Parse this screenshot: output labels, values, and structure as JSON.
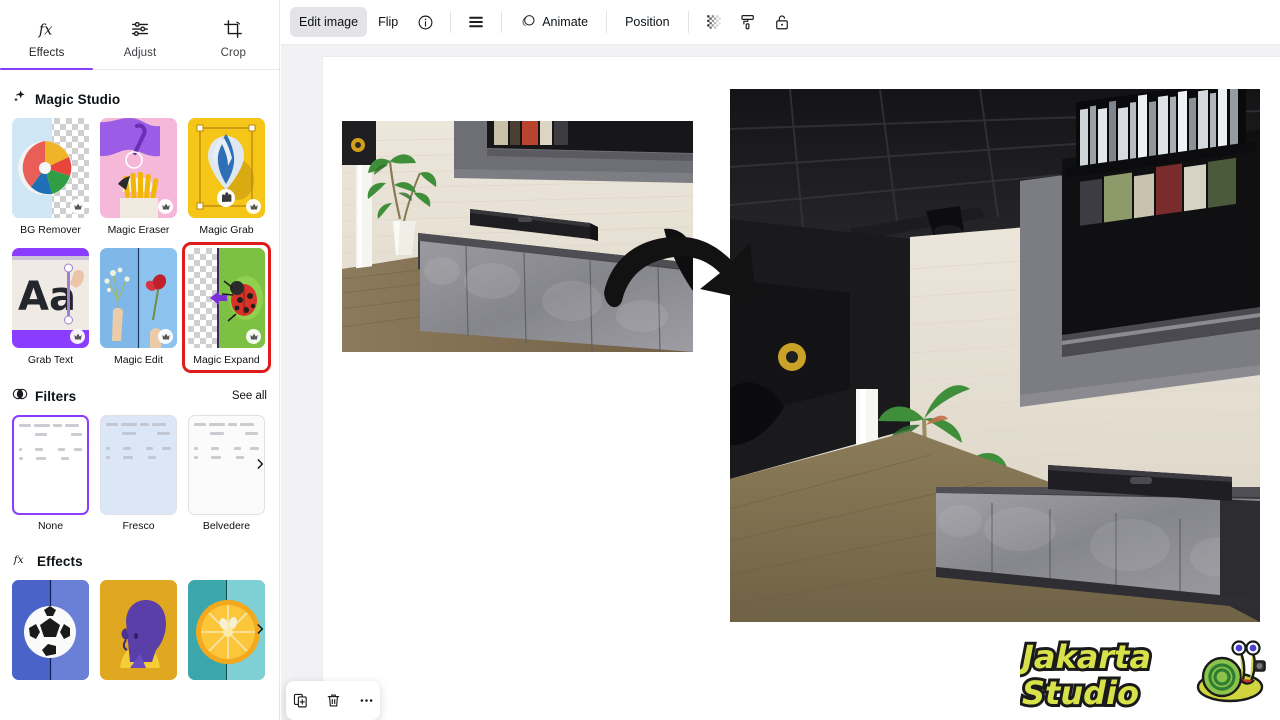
{
  "app": {
    "accent_purple": "#8b3dff",
    "selection_red": "#e01b1b",
    "panel_bg": "#ffffff",
    "canvas_bg": "#f2f2f4"
  },
  "left_panel": {
    "tabs": [
      {
        "label": "Effects",
        "icon": "fx-icon",
        "active": true
      },
      {
        "label": "Adjust",
        "icon": "sliders-icon",
        "active": false
      },
      {
        "label": "Crop",
        "icon": "crop-icon",
        "active": false
      }
    ],
    "magic_studio": {
      "title": "Magic Studio",
      "icon": "sparkle-icon",
      "cards": [
        {
          "label": "BG Remover",
          "premium": true,
          "selected": false
        },
        {
          "label": "Magic Eraser",
          "premium": true,
          "selected": false
        },
        {
          "label": "Magic Grab",
          "premium": true,
          "selected": false
        },
        {
          "label": "Grab Text",
          "premium": true,
          "selected": false
        },
        {
          "label": "Magic Edit",
          "premium": true,
          "selected": false
        },
        {
          "label": "Magic Expand",
          "premium": true,
          "selected": true
        }
      ]
    },
    "filters": {
      "title": "Filters",
      "icon": "filter-circles-icon",
      "see_all": "See all",
      "items": [
        {
          "label": "None",
          "selected": true
        },
        {
          "label": "Fresco",
          "selected": false
        },
        {
          "label": "Belvedere",
          "selected": false
        }
      ],
      "next_arrow": "chevron-right-icon"
    },
    "effects": {
      "title": "Effects",
      "icon": "fx-icon",
      "items": [
        {
          "label": "soccer-ball-effect"
        },
        {
          "label": "portrait-effect"
        },
        {
          "label": "orange-slice-effect"
        }
      ],
      "next_arrow": "chevron-right-icon"
    }
  },
  "toolbar": {
    "edit_image": "Edit image",
    "flip": "Flip",
    "info_icon": "info-icon",
    "align_icon": "align-icon",
    "animate": "Animate",
    "animate_icon": "animate-icon",
    "position": "Position",
    "transparency_icon": "transparency-icon",
    "color_icon": "paint-roller-icon",
    "lock_icon": "unlock-icon"
  },
  "canvas": {
    "before_image": {
      "name": "original-interior-render",
      "description": "3D interior render of living room with grey media console, black soundbar, wall mounted TV, potted palm and white column"
    },
    "after_image": {
      "name": "magic-expanded-interior-render",
      "description": "Same 3D interior render expanded outward showing dark ceiling, larger TV wall, full palm plant, wood floor and longer console"
    },
    "arrow": "curved-arrow-right"
  },
  "bottom_toolbar": {
    "duplicate_icon": "duplicate-icon",
    "delete_icon": "trash-icon",
    "more_icon": "more-options-icon"
  },
  "watermark": {
    "line1": "Jakarta",
    "line2": "Studio",
    "mascot": "snail-mascot-icon"
  }
}
